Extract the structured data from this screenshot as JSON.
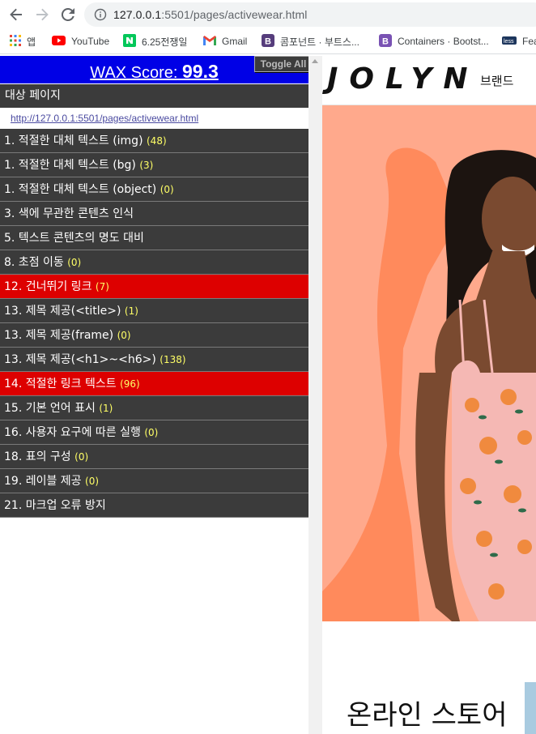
{
  "browser": {
    "url_host": "127.0.0.1",
    "url_rest": ":5501/pages/activewear.html",
    "bookmarks": [
      {
        "label": "앱",
        "icon": "apps-grid-icon"
      },
      {
        "label": "YouTube",
        "icon": "youtube-icon"
      },
      {
        "label": "6.25전쟁일",
        "icon": "naver-icon"
      },
      {
        "label": "Gmail",
        "icon": "gmail-icon"
      },
      {
        "label": "콤포넌트 · 부트스...",
        "icon": "bootstrap-icon"
      },
      {
        "label": "Containers · Bootst...",
        "icon": "bootstrap-icon"
      },
      {
        "label": "Fea",
        "icon": "less-icon"
      }
    ]
  },
  "wax": {
    "title": "WAX Score:",
    "score": "99.3",
    "toggle_label": "Toggle All",
    "target_label": "대상 페이지",
    "target_url": "http://127.0.0.1:5501/pages/activewear.html",
    "items": [
      {
        "label": "1. 적절한 대체 텍스트 (img)",
        "count": "(48)",
        "status": "normal"
      },
      {
        "label": "1. 적절한 대체 텍스트 (bg)",
        "count": "(3)",
        "status": "normal"
      },
      {
        "label": "1. 적절한 대체 텍스트 (object)",
        "count": "(0)",
        "status": "normal"
      },
      {
        "label": "3. 색에 무관한 콘텐츠 인식",
        "count": "",
        "status": "normal"
      },
      {
        "label": "5. 텍스트 콘텐츠의 명도 대비",
        "count": "",
        "status": "normal"
      },
      {
        "label": "8. 초점 이동",
        "count": "(0)",
        "status": "normal"
      },
      {
        "label": "12. 건너뛰기 링크",
        "count": "(7)",
        "status": "error"
      },
      {
        "label": "13. 제목 제공(<title>)",
        "count": "(1)",
        "status": "normal"
      },
      {
        "label": "13. 제목 제공(frame)",
        "count": "(0)",
        "status": "normal"
      },
      {
        "label": "13. 제목 제공(<h1>~<h6>)",
        "count": "(138)",
        "status": "normal"
      },
      {
        "label": "14. 적절한 링크 텍스트",
        "count": "(96)",
        "status": "error"
      },
      {
        "label": "15. 기본 언어 표시",
        "count": "(1)",
        "status": "normal"
      },
      {
        "label": "16. 사용자 요구에 따른 실행",
        "count": "(0)",
        "status": "normal"
      },
      {
        "label": "18. 표의 구성",
        "count": "(0)",
        "status": "normal"
      },
      {
        "label": "19. 레이블 제공",
        "count": "(0)",
        "status": "normal"
      },
      {
        "label": "21. 마크업 오류 방지",
        "count": "",
        "status": "normal"
      }
    ],
    "colors": {
      "header": "#0000e6",
      "row": "#3b3b3b",
      "error_row": "#dd0000",
      "count": "#ffff66"
    }
  },
  "site": {
    "logo": "JOLYN",
    "nav_brand": "브랜드",
    "section_title": "온라인 스토어",
    "hero_bg": "#ffa98c"
  }
}
